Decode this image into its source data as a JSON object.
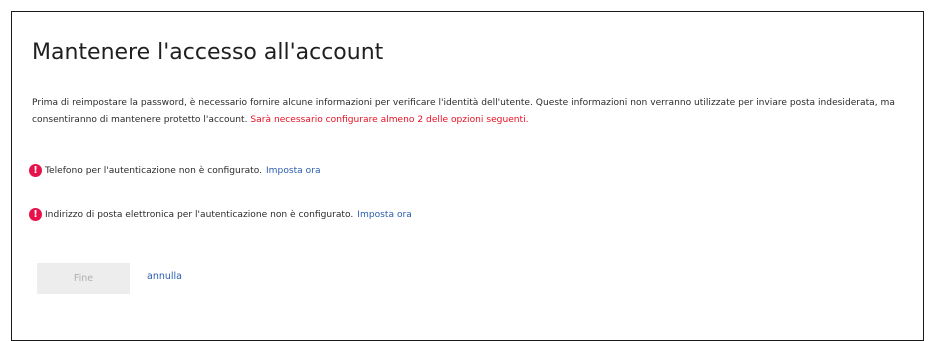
{
  "page": {
    "title": "Mantenere l'accesso all'account",
    "intro_text": "Prima di reimpostare la password, è necessario fornire alcune informazioni per verificare l'identità dell'utente. Queste informazioni non verranno utilizzate per inviare posta indesiderata, ma consentiranno di mantenere protetto l'account. ",
    "intro_warning": "Sarà necessario configurare almeno 2 delle opzioni seguenti."
  },
  "options": [
    {
      "icon": "alert-icon",
      "text": "Telefono per l'autenticazione non è configurato.",
      "link": "Imposta ora"
    },
    {
      "icon": "alert-icon",
      "text": "Indirizzo di posta elettronica per l'autenticazione non è configurato.",
      "link": "Imposta ora"
    }
  ],
  "actions": {
    "finish_label": "Fine",
    "finish_enabled": false,
    "cancel_label": "annulla"
  },
  "colors": {
    "warning": "#e81123",
    "alert_icon": "#e8124a",
    "link": "#2a5db0",
    "disabled_button_bg": "#ededed",
    "disabled_button_text": "#b0b0b0"
  }
}
